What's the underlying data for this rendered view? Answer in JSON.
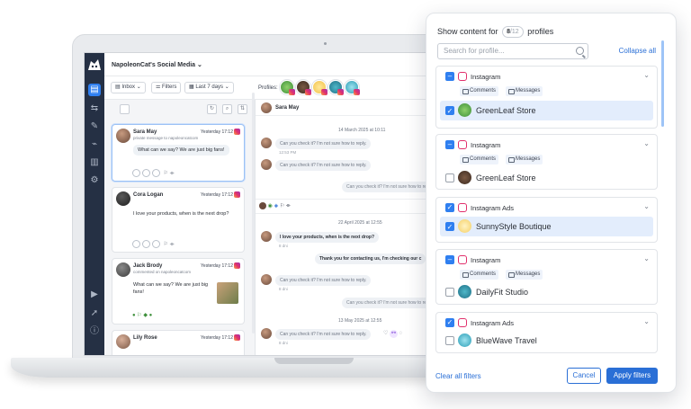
{
  "app": {
    "workspace": "NapoleonCat's Social Media"
  },
  "filters": {
    "inbox": "Inbox",
    "filters": "Filters",
    "period": "Last 7 days",
    "profiles_label": "Profiles:"
  },
  "messages": [
    {
      "name": "Sara May",
      "subtitle": "private message to napoleoncatcom",
      "time": "Yesterday 17:12",
      "text": "What can we say? We are just big fans!"
    },
    {
      "name": "Cora Logan",
      "subtitle": "",
      "time": "Yesterday 17:12",
      "text": "I love your products, when is the next drop?"
    },
    {
      "name": "Jack Brody",
      "subtitle": "commented on napoleoncatcom",
      "time": "Yesterday 17:12",
      "text": "What can we say? We are just big fans!"
    },
    {
      "name": "Lily Rose",
      "subtitle": "",
      "time": "Yesterday 17:12",
      "text": ""
    }
  ],
  "conversation": {
    "header_name": "Sara May",
    "date1": "14 March 2025 at 10:11",
    "in1": "Can you check it? I'm not sure how to reply.",
    "in1_time": "12:53 PM",
    "in2": "Can you check it? I'm not sure how to reply.",
    "out1": "Can you check it? I'm not sure how to reply.",
    "date2": "22 April 2025 at 12:55",
    "in3": "I love your products, when is the next drop?",
    "in3_meta": "8 dni",
    "out2": "Thank you for contacting us, I'm checking our c",
    "in4": "Can you check it? I'm not sure how to reply.",
    "in4_meta": "8 dni",
    "out3": "Can you check it? I'm not sure how to reply.",
    "date3": "13 May 2025 at 12:55",
    "in5": "Can you check it? I'm not sure how to reply.",
    "in5_meta": "8 dni"
  },
  "panel": {
    "title_prefix": "Show content for",
    "count_selected": "8",
    "count_total": "/12",
    "title_suffix": "profiles",
    "search_placeholder": "Search for profile...",
    "collapse_all": "Collapse all",
    "clear_all": "Clear all filters",
    "cancel": "Cancel",
    "apply": "Apply filters",
    "comments_tag": "Comments",
    "messages_tag": "Messages",
    "groups": [
      {
        "network": "Instagram",
        "profile": "GreenLeaf Store",
        "checked": true
      },
      {
        "network": "Instagram",
        "profile": "GreenLeaf Store",
        "checked": false
      },
      {
        "network": "Instagram Ads",
        "profile": "SunnyStyle Boutique",
        "checked": true
      },
      {
        "network": "Instagram",
        "profile": "DailyFit Studio",
        "checked": false
      },
      {
        "network": "Instagram Ads",
        "profile": "BlueWave Travel",
        "checked": false
      }
    ]
  },
  "colors": {
    "accent": "#2a6fd6",
    "sidebar": "#253044",
    "selected_row": "#e3edfc"
  }
}
